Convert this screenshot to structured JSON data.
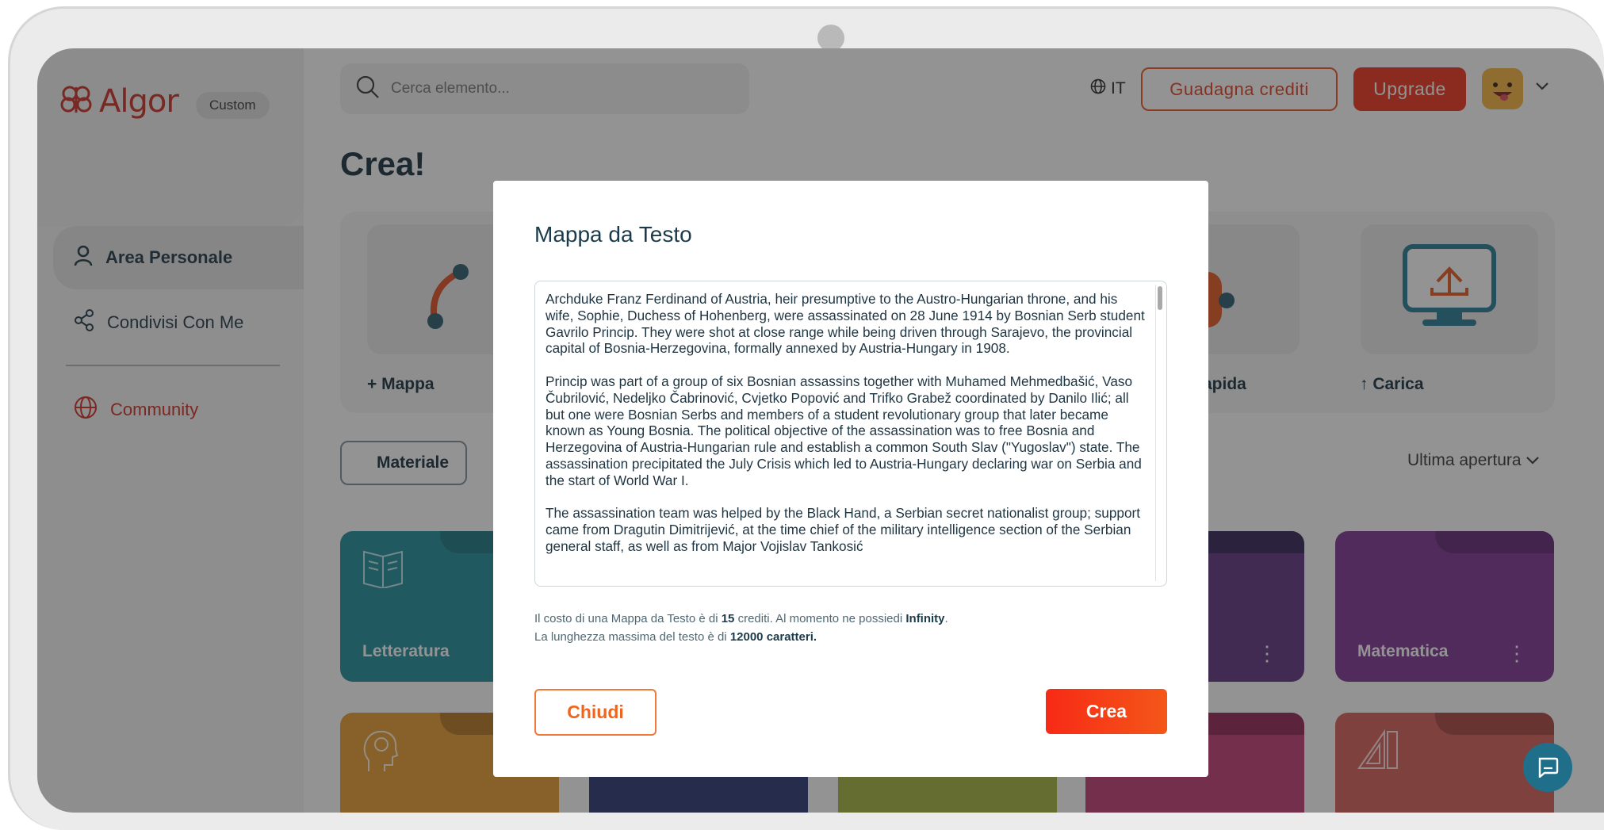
{
  "sidebar": {
    "logo_text": "Algor",
    "badge": "Custom",
    "items": [
      {
        "label": "Area Personale"
      },
      {
        "label": "Condivisi Con Me"
      },
      {
        "label": "Community"
      }
    ]
  },
  "topbar": {
    "search_placeholder": "Cerca elemento...",
    "language": "IT",
    "earn_credits": "Guadagna crediti",
    "upgrade": "Upgrade"
  },
  "main": {
    "title": "Crea!",
    "create_options": [
      {
        "label": "+ Mappa"
      },
      {
        "label": "apida"
      },
      {
        "label": "↑ Carica"
      }
    ],
    "tab_label": "Materiale",
    "sort_label": "Ultima apertura",
    "folders": [
      {
        "name": "Letteratura",
        "color": "#1a8a9a"
      },
      {
        "name": "",
        "color": "#5b2f7c"
      },
      {
        "name": "Matematica",
        "color": "#7b2f8f"
      },
      {
        "name": "",
        "color": "#e79a2a"
      },
      {
        "name": "",
        "color": "#233170"
      },
      {
        "name": "",
        "color": "#a3b23a"
      },
      {
        "name": "",
        "color": "#c03670"
      },
      {
        "name": "",
        "color": "#d45a55"
      }
    ]
  },
  "modal": {
    "title": "Mappa da Testo",
    "paragraphs": [
      "Archduke Franz Ferdinand of Austria, heir presumptive to the Austro-Hungarian throne, and his wife, Sophie, Duchess of Hohenberg, were assassinated on 28 June 1914 by Bosnian Serb student Gavrilo Princip. They were shot at close range while being driven through Sarajevo, the provincial capital of Bosnia-Herzegovina, formally annexed by Austria-Hungary in 1908.",
      "Princip was part of a group of six Bosnian assassins together with Muhamed Mehmedbašić, Vaso Čubrilović, Nedeljko Čabrinović, Cvjetko Popović and Trifko Grabež coordinated by Danilo Ilić; all but one were Bosnian Serbs and members of a student revolutionary group that later became known as Young Bosnia. The political objective of the assassination was to free Bosnia and Herzegovina of Austria-Hungarian rule and establish a common South Slav (\"Yugoslav\") state. The assassination precipitated the July Crisis which led to Austria-Hungary declaring war on Serbia and the start of World War I.",
      "The assassination team was helped by the Black Hand, a Serbian secret nationalist group; support came from Dragutin Dimitrijević, at the time chief of the military intelligence section of the Serbian general staff, as well as from Major Vojislav Tankosić"
    ],
    "cost": {
      "prefix": "Il costo di una Mappa da Testo è di ",
      "credits": "15",
      "middle": " crediti. Al momento ne possiedi ",
      "balance": "Infinity",
      "suffix": "."
    },
    "length": {
      "prefix": "La lunghezza massima del testo è di ",
      "max": "12000 caratteri."
    },
    "close_label": "Chiudi",
    "create_label": "Crea"
  }
}
